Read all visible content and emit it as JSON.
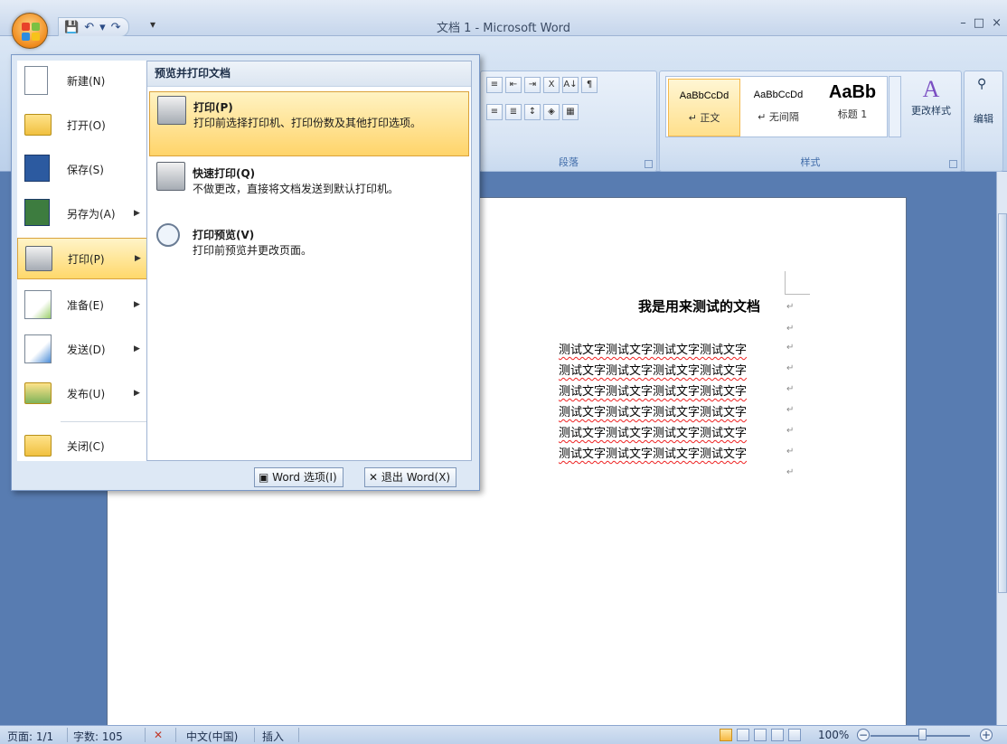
{
  "window": {
    "title": "文档 1 - Microsoft Word",
    "controls": [
      "–",
      "□",
      "×"
    ]
  },
  "qat": {
    "save_icon": "save-icon",
    "undo": "↶",
    "undo_dropdown": "▾",
    "redo": "↷",
    "customize": "▾"
  },
  "ribbon": {
    "paragraph_group_label": "段落",
    "styles_group_label": "样式",
    "styles": [
      {
        "sample": "AaBbCcDd",
        "name": "↵ 正文"
      },
      {
        "sample": "AaBbCcDd",
        "name": "↵ 无间隔"
      },
      {
        "sample": "AaBb",
        "name": "标题 1"
      }
    ],
    "change_styles_label": "更改样式",
    "edit_label": "编辑"
  },
  "office_menu": {
    "left_items": [
      {
        "label": "新建(N)"
      },
      {
        "label": "打开(O)"
      },
      {
        "label": "保存(S)"
      },
      {
        "label": "另存为(A)"
      },
      {
        "label": "打印(P)"
      },
      {
        "label": "准备(E)"
      },
      {
        "label": "发送(D)"
      },
      {
        "label": "发布(U)"
      },
      {
        "label": "关闭(C)"
      }
    ],
    "submenu_header": "预览并打印文档",
    "submenu_items": [
      {
        "title": "打印(P)",
        "desc": "打印前选择打印机、打印份数及其他打印选项。"
      },
      {
        "title": "快速打印(Q)",
        "desc": "不做更改，直接将文档发送到默认打印机。"
      },
      {
        "title": "打印预览(V)",
        "desc": "打印前预览并更改页面。"
      }
    ],
    "word_options_label": "Word 选项(I)",
    "exit_word_label": "退出 Word(X)"
  },
  "document": {
    "title": "我是用来测试的文档",
    "lines": [
      "测试文字测试文字测试文字测试文字",
      "测试文字测试文字测试文字测试文字",
      "测试文字测试文字测试文字测试文字",
      "测试文字测试文字测试文字测试文字",
      "测试文字测试文字测试文字测试文字",
      "测试文字测试文字测试文字测试文字"
    ],
    "para_mark": "↵"
  },
  "status": {
    "page": "页面: 1/1",
    "words": "字数: 105",
    "language": "中文(中国)",
    "mode": "插入",
    "zoom": "100%",
    "zoom_out": "−",
    "zoom_in": "+"
  }
}
